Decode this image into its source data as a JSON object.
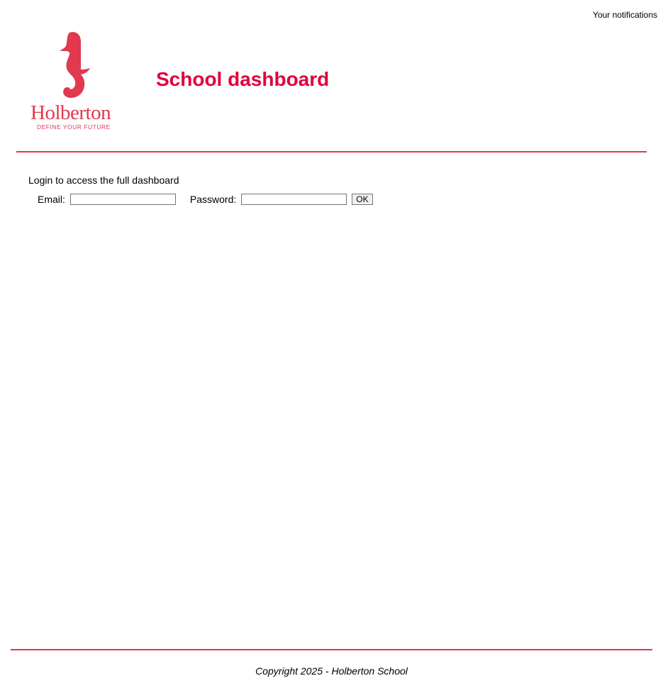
{
  "notifications": {
    "label": "Your notifications"
  },
  "header": {
    "title": "School dashboard",
    "logo_text": "Holberton",
    "logo_tagline": "DEFINE YOUR FUTURE",
    "accent": "#e0003c"
  },
  "login": {
    "intro": "Login to access the full dashboard",
    "email_label": "Email:",
    "email_value": "",
    "password_label": "Password:",
    "password_value": "",
    "submit_label": "OK"
  },
  "footer": {
    "copyright": "Copyright 2025 - Holberton School"
  }
}
